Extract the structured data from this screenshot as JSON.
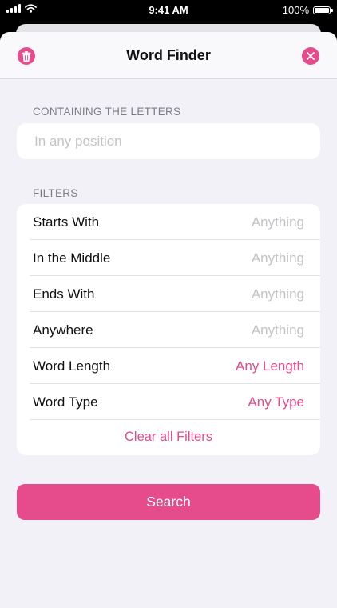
{
  "status_bar": {
    "time": "9:41 AM",
    "battery_text": "100%"
  },
  "nav": {
    "title": "Word Finder"
  },
  "containing": {
    "section_label": "CONTAINING THE LETTERS",
    "value": "",
    "placeholder": "In any position"
  },
  "filters": {
    "section_label": "FILTERS",
    "rows": [
      {
        "label": "Starts With",
        "value": "Anything"
      },
      {
        "label": "In the Middle",
        "value": "Anything"
      },
      {
        "label": "Ends With",
        "value": "Anything"
      },
      {
        "label": "Anywhere",
        "value": "Anything"
      },
      {
        "label": "Word Length",
        "value": "Any Length"
      },
      {
        "label": "Word Type",
        "value": "Any Type"
      }
    ],
    "clear_label": "Clear all Filters"
  },
  "search_button": {
    "label": "Search"
  },
  "colors": {
    "accent": "#e64c8c",
    "background": "#f2f1f7"
  },
  "icons": {
    "left_nav": "trash-icon",
    "right_nav": "close-icon",
    "status": [
      "signal-icon",
      "wifi-icon",
      "battery-icon"
    ]
  }
}
